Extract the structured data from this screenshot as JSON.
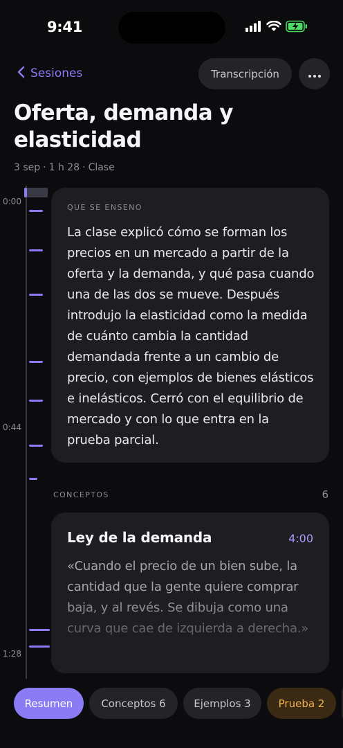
{
  "status": {
    "time": "9:41",
    "icons": [
      "signal-icon",
      "wifi-icon",
      "battery-charging-icon"
    ],
    "battery_color": "#4cd964"
  },
  "nav": {
    "back_label": "Sesiones",
    "transcript_label": "Transcripción",
    "more_icon": "ellipsis-icon"
  },
  "session": {
    "title": "Oferta, demanda y elasticidad",
    "date": "3 sep",
    "duration": "1 h 28",
    "type": "Clase",
    "separator": "·"
  },
  "timeline": {
    "labels": [
      "0:00",
      "0:44",
      "1:28"
    ]
  },
  "summary": {
    "label": "QUE SE ENSENO",
    "text": "La clase explicó cómo se forman los precios en un mercado a partir de la oferta y la demanda, y qué pasa cuando una de las dos se mueve. Después introdujo la elasticidad como la medida de cuánto cambia la cantidad demandada frente a un cambio de precio, con ejemplos de bienes elásticos e inelásticos. Cerró con el equilibrio de mercado y con lo que entra en la prueba parcial."
  },
  "concepts": {
    "label": "CONCEPTOS",
    "count": "6",
    "items": [
      {
        "title": "Ley de la demanda",
        "time": "4:00",
        "quote": "«Cuando el precio de un bien sube, la cantidad que la gente quiere comprar baja, y al revés. Se dibuja como una curva que cae de izquierda a derecha.»"
      }
    ]
  },
  "tabs": [
    {
      "label": "Resumen",
      "active": true
    },
    {
      "label": "Conceptos 6",
      "active": false
    },
    {
      "label": "Ejemplos 3",
      "active": false
    },
    {
      "label": "Prueba 2",
      "active": false
    }
  ],
  "colors": {
    "accent": "#8b7cf6",
    "background": "#0c0c0f",
    "card": "#1d1d22",
    "quiz_text": "#f2b650",
    "quiz_bg": "#3a2a14"
  }
}
